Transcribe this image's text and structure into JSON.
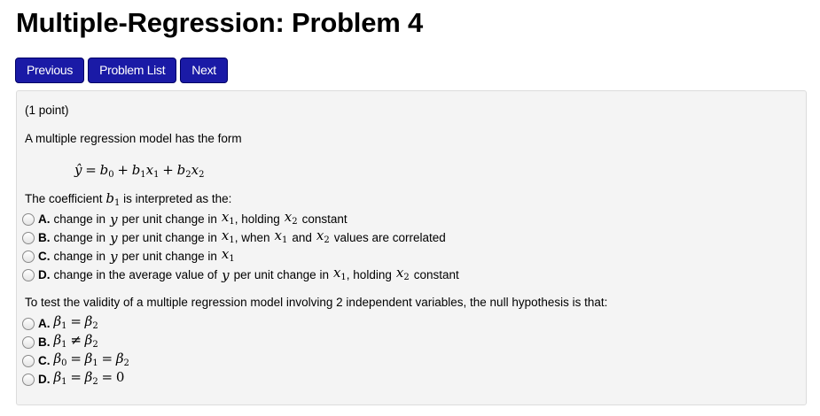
{
  "page": {
    "title": "Multiple-Regression: Problem 4"
  },
  "nav": {
    "previous": "Previous",
    "problem_list": "Problem List",
    "next": "Next"
  },
  "problem": {
    "points": "(1 point)",
    "intro": "A multiple regression model has the form",
    "formula": {
      "lhs": "ŷ",
      "eq": "=",
      "b0": "b",
      "b0_sub": "0",
      "plus1": "+",
      "b1": "b",
      "b1_sub": "1",
      "x1": "x",
      "x1_sub": "1",
      "plus2": "+",
      "b2": "b",
      "b2_sub": "2",
      "x2": "x",
      "x2_sub": "2"
    },
    "q1": {
      "stem_pre": "The coefficient",
      "stem_var": "b",
      "stem_sub": "1",
      "stem_post": "is interpreted as the:",
      "options": [
        {
          "letter": "A.",
          "t1": "change in",
          "v1": "y",
          "t2": "per unit change in",
          "v2": "x",
          "s2": "1",
          "t3": ", holding",
          "v3": "x",
          "s3": "2",
          "t4": "constant"
        },
        {
          "letter": "B.",
          "t1": "change in",
          "v1": "y",
          "t2": "per unit change in",
          "v2": "x",
          "s2": "1",
          "t3": ", when",
          "v3": "x",
          "s3": "1",
          "t4": "and",
          "v4": "x",
          "s4": "2",
          "t5": "values are correlated"
        },
        {
          "letter": "C.",
          "t1": "change in",
          "v1": "y",
          "t2": "per unit change in",
          "v2": "x",
          "s2": "1"
        },
        {
          "letter": "D.",
          "t1": "change in the average value of",
          "v1": "y",
          "t2": "per unit change in",
          "v2": "x",
          "s2": "1",
          "t3": ", holding",
          "v3": "x",
          "s3": "2",
          "t4": "constant"
        }
      ]
    },
    "q2": {
      "stem": "To test the validity of a multiple regression model involving 2 independent variables, the null hypothesis is that:",
      "options": [
        {
          "letter": "A.",
          "math": [
            [
              "β",
              "1"
            ],
            "=",
            [
              "β",
              "2"
            ]
          ]
        },
        {
          "letter": "B.",
          "math": [
            [
              "β",
              "1"
            ],
            "≠",
            [
              "β",
              "2"
            ]
          ]
        },
        {
          "letter": "C.",
          "math": [
            [
              "β",
              "0"
            ],
            "=",
            [
              "β",
              "1"
            ],
            "=",
            [
              "β",
              "2"
            ]
          ]
        },
        {
          "letter": "D.",
          "math": [
            [
              "β",
              "1"
            ],
            "=",
            [
              "β",
              "2"
            ],
            "=",
            "0"
          ]
        }
      ]
    }
  }
}
